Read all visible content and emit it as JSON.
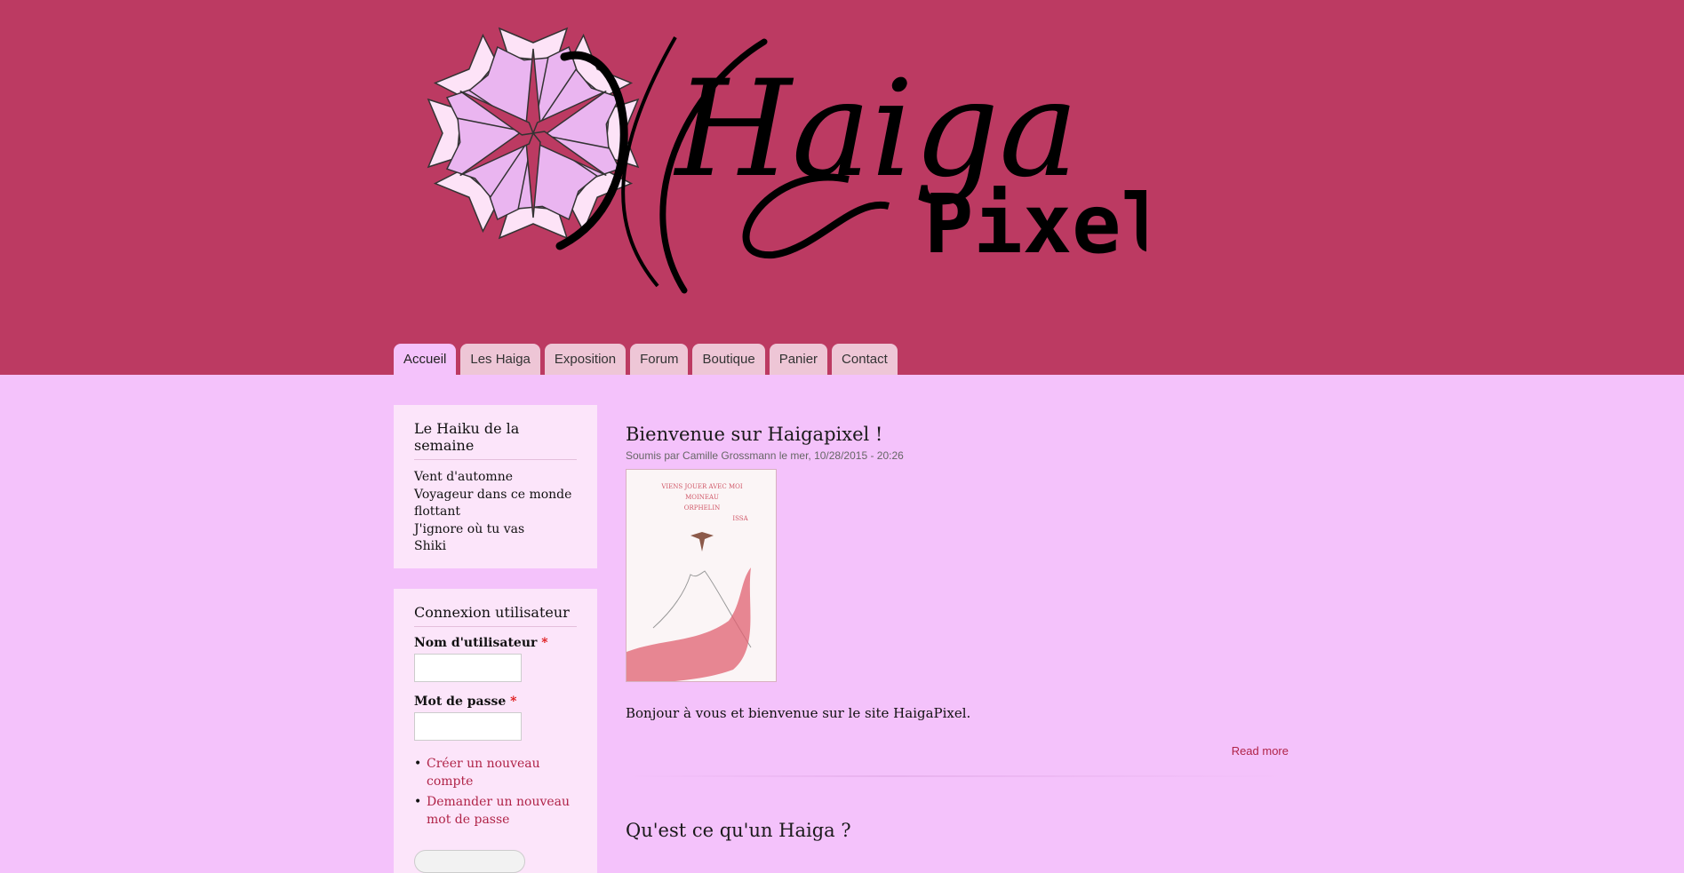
{
  "site": {
    "logo_text_main": "Haiga",
    "logo_text_sub": "Pixel"
  },
  "nav": {
    "tabs": [
      {
        "label": "Accueil"
      },
      {
        "label": "Les Haiga"
      },
      {
        "label": "Exposition"
      },
      {
        "label": "Forum"
      },
      {
        "label": "Boutique"
      },
      {
        "label": "Panier"
      },
      {
        "label": "Contact"
      }
    ]
  },
  "haiku_block": {
    "title": "Le Haiku de la semaine",
    "lines": [
      "Vent d'automne",
      "Voyageur dans ce monde",
      "flottant",
      "J'ignore où tu vas",
      "Shiki"
    ]
  },
  "login_block": {
    "title": "Connexion utilisateur",
    "username_label": "Nom d'utilisateur",
    "password_label": "Mot de passe",
    "required_marker": "*",
    "links": [
      "Créer un nouveau compte",
      "Demander un nouveau mot de passe"
    ]
  },
  "articles": [
    {
      "title": "Bienvenue sur Haigapixel !",
      "submitted": "Soumis par Camille Grossmann le mer, 10/28/2015 - 20:26",
      "image_text": [
        "VIENS JOUER AVEC MOI",
        "MOINEAU",
        "ORPHELIN",
        "ISSA"
      ],
      "body": "Bonjour à vous et bienvenue sur le site HaigaPixel.",
      "read_more": "Read more"
    },
    {
      "title": "Qu'est ce qu'un Haiga ?"
    }
  ],
  "colors": {
    "header_bg": "#bc3a62",
    "page_bg": "#f4c2fb",
    "block_bg": "#fce5fa",
    "link": "#b02448"
  }
}
